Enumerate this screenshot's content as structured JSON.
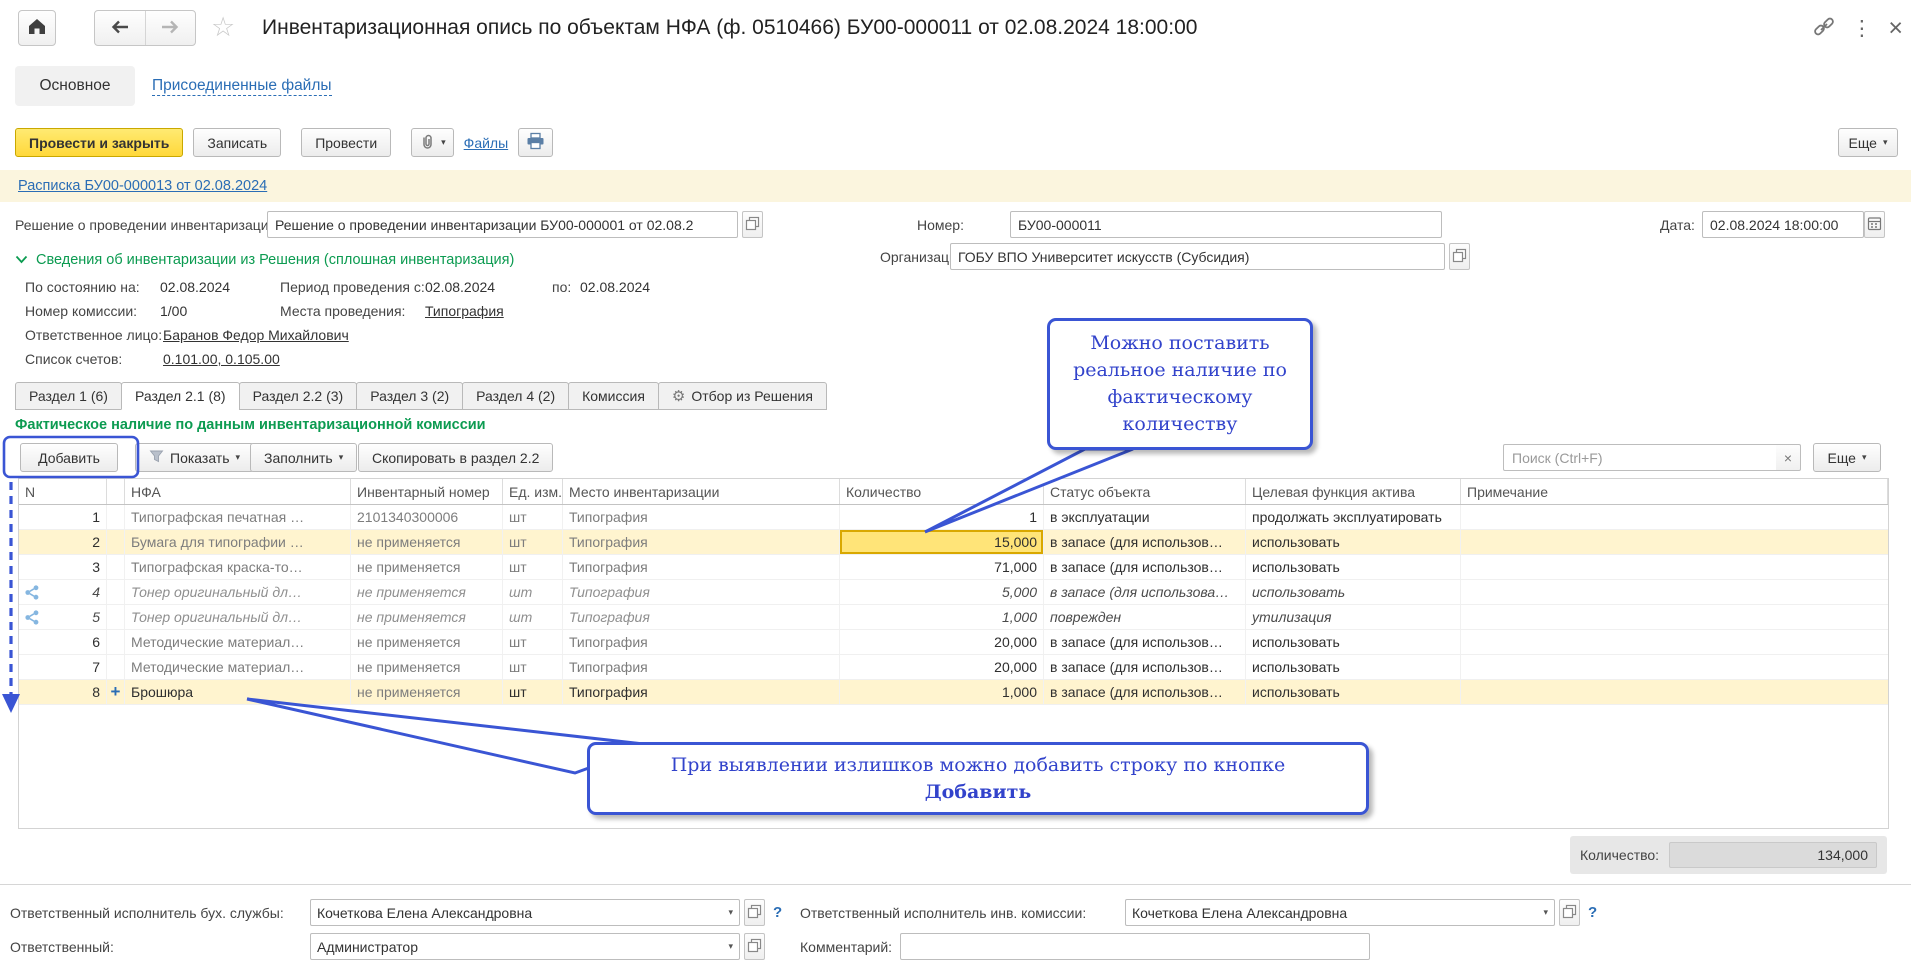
{
  "window": {
    "title": "Инвентаризационная опись по объектам НФА (ф. 0510466) БУ00-000011 от 02.08.2024 18:00:00"
  },
  "nav_tabs": {
    "main": "Основное",
    "attached": "Присоединенные файлы"
  },
  "toolbar": {
    "post_close": "Провести и закрыть",
    "write": "Записать",
    "post": "Провести",
    "files": "Файлы",
    "more": "Еще",
    "caret": "▾"
  },
  "receipt_link": "Расписка БУ00-000013 от 02.08.2024",
  "header_fields": {
    "decision_label": "Решение о проведении инвентаризации:",
    "decision_value": "Решение о проведении инвентаризации БУ00-000001 от 02.08.2",
    "number_label": "Номер:",
    "number_value": "БУ00-000011",
    "date_label": "Дата:",
    "date_value": "02.08.2024 18:00:00",
    "org_label": "Организация:",
    "org_value": "ГОБУ ВПО Университет искусств (Субсидия)"
  },
  "info": {
    "title": "Сведения об инвентаризации из Решения (сплошная инвентаризация)",
    "as_of_label": "По состоянию на:",
    "as_of": "02.08.2024",
    "period_from_label": "Период проведения с:",
    "period_from": "02.08.2024",
    "period_to_label": "по:",
    "period_to": "02.08.2024",
    "commission_label": "Номер комиссии:",
    "commission": "1/00",
    "places_label": "Места проведения:",
    "places": "Типография",
    "person_label": "Ответственное лицо:",
    "person": "Баранов Федор Михайлович",
    "accounts_label": "Список счетов:",
    "accounts": "0.101.00, 0.105.00"
  },
  "section_tabs": [
    {
      "label": "Раздел 1 (6)",
      "active": false,
      "icon": ""
    },
    {
      "label": "Раздел 2.1 (8)",
      "active": true,
      "icon": ""
    },
    {
      "label": "Раздел 2.2 (3)",
      "active": false,
      "icon": ""
    },
    {
      "label": "Раздел 3 (2)",
      "active": false,
      "icon": ""
    },
    {
      "label": "Раздел 4 (2)",
      "active": false,
      "icon": ""
    },
    {
      "label": "Комиссия",
      "active": false,
      "icon": ""
    },
    {
      "label": "Отбор из Решения",
      "active": false,
      "icon": "gear"
    }
  ],
  "grid": {
    "caption": "Фактическое наличие по данным инвентаризационной комиссии",
    "buttons": {
      "add": "Добавить",
      "show": "Показать",
      "fill": "Заполнить",
      "copy": "Скопировать в раздел 2.2",
      "more": "Еще"
    },
    "search_placeholder": "Поиск (Ctrl+F)",
    "columns": {
      "n": "N",
      "nfa": "НФА",
      "inv": "Инвентарный номер",
      "unit": "Ед. изм.",
      "place": "Место инвентаризации",
      "qty": "Количество",
      "status": "Статус объекта",
      "func": "Целевая функция актива",
      "note": "Примечание"
    },
    "rows": [
      {
        "n": "1",
        "nfa": "Типографская печатная …",
        "inv": "2101340300006",
        "unit": "шт",
        "place": "Типография",
        "qty": "1",
        "status": "в эксплуатации",
        "func": "продолжать эксплуатировать",
        "note": "",
        "style": "normal",
        "icon": ""
      },
      {
        "n": "2",
        "nfa": "Бумага для типографии …",
        "inv": "не применяется",
        "unit": "шт",
        "place": "Типография",
        "qty": "15,000",
        "status": "в запасе (для использов…",
        "func": "использовать",
        "note": "",
        "style": "selected",
        "icon": ""
      },
      {
        "n": "3",
        "nfa": "Типографская краска-то…",
        "inv": "не применяется",
        "unit": "шт",
        "place": "Типография",
        "qty": "71,000",
        "status": "в запасе (для использов…",
        "func": "использовать",
        "note": "",
        "style": "normal",
        "icon": ""
      },
      {
        "n": "4",
        "nfa": "Тонер оригинальный дл…",
        "inv": "не применяется",
        "unit": "шт",
        "place": "Типография",
        "qty": "5,000",
        "status": "в запасе (для использова…",
        "func": "использовать",
        "note": "",
        "style": "italic",
        "icon": "share"
      },
      {
        "n": "5",
        "nfa": "Тонер оригинальный дл…",
        "inv": "не применяется",
        "unit": "шт",
        "place": "Типография",
        "qty": "1,000",
        "status": "поврежден",
        "func": "утилизация",
        "note": "",
        "style": "italic",
        "icon": "share"
      },
      {
        "n": "6",
        "nfa": "Методические материал…",
        "inv": "не применяется",
        "unit": "шт",
        "place": "Типография",
        "qty": "20,000",
        "status": "в запасе (для использов…",
        "func": "использовать",
        "note": "",
        "style": "normal",
        "icon": ""
      },
      {
        "n": "7",
        "nfa": "Методические материал…",
        "inv": "не применяется",
        "unit": "шт",
        "place": "Типография",
        "qty": "20,000",
        "status": "в запасе (для использов…",
        "func": "использовать",
        "note": "",
        "style": "normal",
        "icon": ""
      },
      {
        "n": "8",
        "nfa": "Брошюра",
        "inv": "не применяется",
        "unit": "шт",
        "place": "Типография",
        "qty": "1,000",
        "status": "в запасе (для использов…",
        "func": "использовать",
        "note": "",
        "style": "added",
        "icon": "plus"
      }
    ],
    "total_label": "Количество:",
    "total_value": "134,000"
  },
  "callouts": {
    "qty": "Можно поставить реальное наличие по фактическому количеству",
    "add_text": "При выявлении излишков можно добавить строку по кнопке",
    "add_bold": "Добавить"
  },
  "footer": {
    "acc_label": "Ответственный исполнитель бух. службы:",
    "acc_value": "Кочеткова Елена Александровна",
    "inv_label": "Ответственный исполнитель инв. комиссии:",
    "inv_value": "Кочеткова Елена Александровна",
    "resp_label": "Ответственный:",
    "resp_value": "Администратор",
    "comment_label": "Комментарий:",
    "comment_value": "",
    "help": "?"
  },
  "colors": {
    "accent_yellow": "#FFD83A",
    "green": "#0C9B51",
    "link_blue": "#2A6DB5",
    "callout_blue": "#3A55D4",
    "row_selected": "#FFF4CF",
    "cell_highlight": "#FFE478"
  }
}
